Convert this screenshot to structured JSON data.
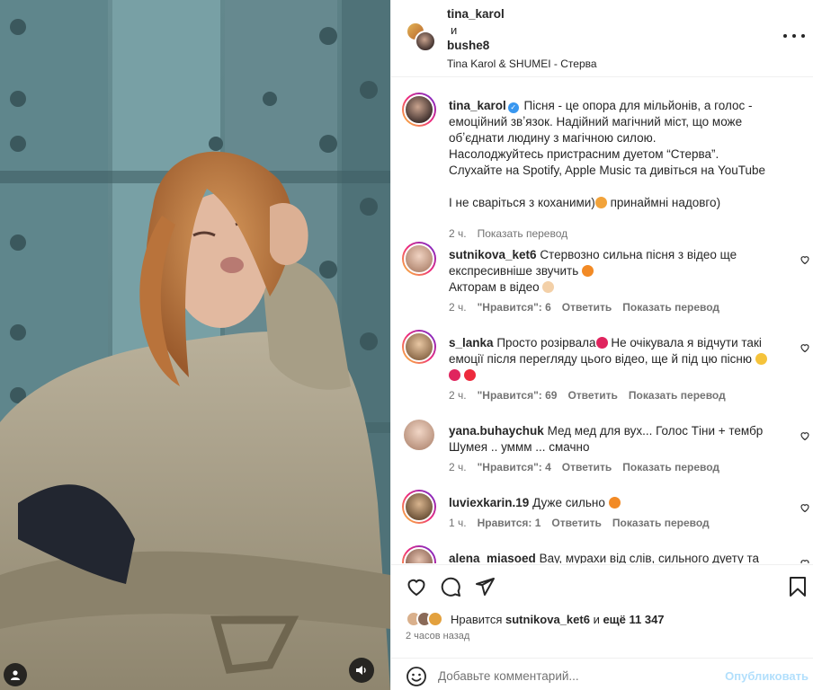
{
  "header": {
    "user1": "tina_karol",
    "and": "и",
    "user2": "bushe8",
    "song": "Tina Karol & SHUMEI - Стерва"
  },
  "caption": {
    "user": "tina_karol",
    "text1": "Пісня - це опора для мільйонів, а голос - емоційний звʼязок. Надійний магічний міст, що може обʼєднати людину з магічною силою.",
    "text2": "Насолоджуйтесь пристрасним дуетом “Стерва”. Слухайте на Spotify, Apple Music  та дивіться на YouTube",
    "text3": "І не сваріться з коханими)",
    "text3b": " принаймні надовго)",
    "time": "2 ч.",
    "translate": "Показать перевод"
  },
  "comments": [
    {
      "user": "sutnikova_ket6",
      "text": "Стервозно сильна пісня з відео ще експресивніше звучить",
      "text2": "Акторам в відео",
      "time": "2 ч.",
      "likes": "\"Нравится\": 6",
      "reply": "Ответить",
      "translate": "Показать перевод"
    },
    {
      "user": "s_lanka",
      "text": "Просто розірвала",
      "text2": " Не очікувала я відчути такі емоції після перегляду цього відео, ще й під цю пісню",
      "time": "2 ч.",
      "likes": "\"Нравится\": 69",
      "reply": "Ответить",
      "translate": "Показать перевод"
    },
    {
      "user": "yana.buhaychuk",
      "text": "Мед мед для вух... Голос Тіни + тембр Шумея .. уммм ... смачно",
      "time": "2 ч.",
      "likes": "\"Нравится\": 4",
      "reply": "Ответить",
      "translate": "Показать перевод"
    },
    {
      "user": "luviexkarin.19",
      "text": "Дуже сильно",
      "time": "1 ч.",
      "likes": "Нравится: 1",
      "reply": "Ответить",
      "translate": "Показать перевод"
    },
    {
      "user": "alena_miasoed",
      "text": "Вау, мурахи від слів, сильного дуету та"
    }
  ],
  "likes": {
    "prefix": "Нравится",
    "user": "sutnikova_ket6",
    "middle": "и",
    "others": "ещё 11 347"
  },
  "time_ago": "2 часов назад",
  "composer": {
    "placeholder": "Добавьте комментарий...",
    "post_label": "Опубликовать"
  },
  "colors": {
    "accent": "#0095f6",
    "post_disabled": "#b2dffc",
    "heart_red": "#ed4956",
    "verified": "#3897f0"
  }
}
